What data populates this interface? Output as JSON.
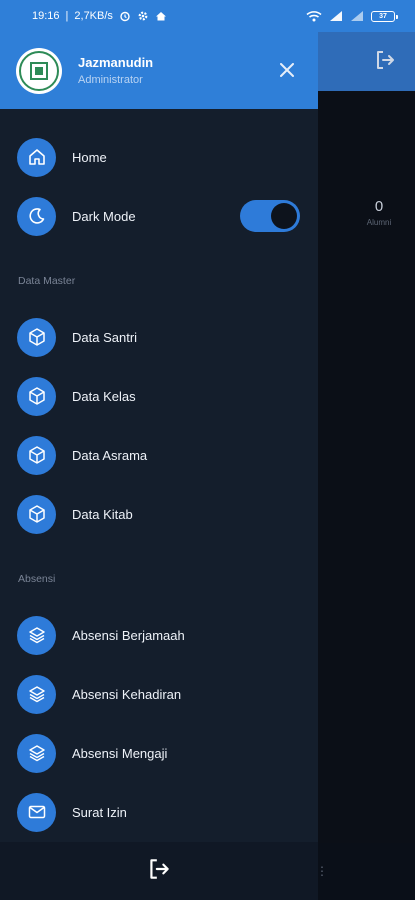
{
  "status_bar": {
    "time": "19:16",
    "network_speed": "2,7KB/s",
    "battery": "37"
  },
  "drawer": {
    "user": {
      "name": "Jazmanudin",
      "role": "Administrator"
    },
    "items": {
      "home": "Home",
      "dark_mode": "Dark Mode",
      "data_santri": "Data Santri",
      "data_kelas": "Data Kelas",
      "data_asrama": "Data Asrama",
      "data_kitab": "Data Kitab",
      "absensi_berjamaah": "Absensi Berjamaah",
      "absensi_kehadiran": "Absensi Kehadiran",
      "absensi_mengaji": "Absensi Mengaji",
      "surat_izin": "Surat Izin"
    },
    "sections": {
      "data_master": "Data Master",
      "absensi": "Absensi"
    },
    "dark_mode_enabled": true
  },
  "background": {
    "stat_value": "0",
    "stat_label": "Alumni"
  },
  "colors": {
    "accent": "#2e7bd9",
    "drawer_bg": "#141e2c",
    "header_blue": "#2f7fd8"
  },
  "icons": {
    "header_logout": "logout-icon",
    "close": "close-icon",
    "home": "home-icon",
    "dark_mode": "moon-icon",
    "data": "cube-icon",
    "absensi": "layers-icon",
    "surat": "mail-icon"
  }
}
